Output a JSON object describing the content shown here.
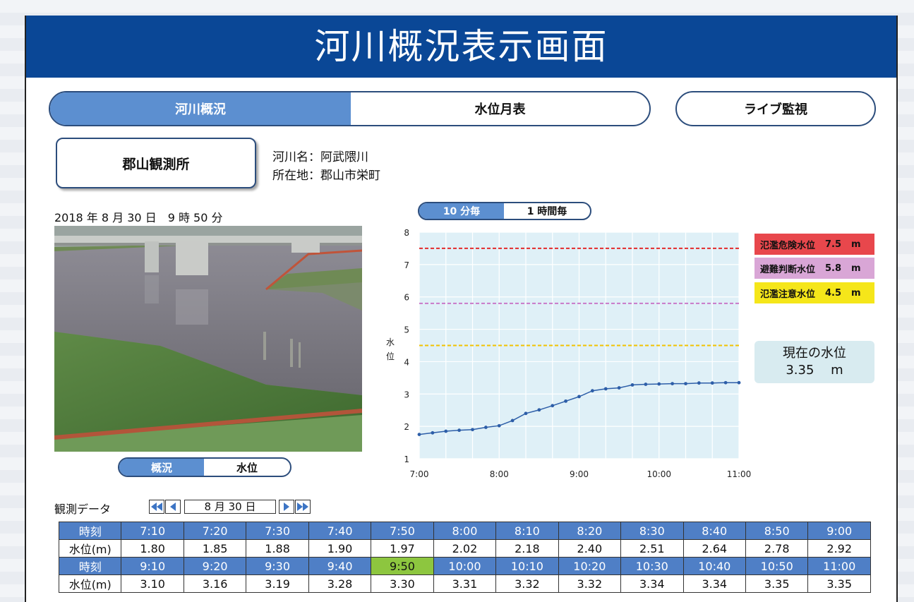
{
  "header": {
    "title": "河川概況表示画面"
  },
  "tabs": {
    "river_overview": "河川概況",
    "monthly_table": "水位月表",
    "live_monitor": "ライブ監視"
  },
  "station": {
    "name": "郡山観測所",
    "river_line": "河川名：阿武隈川",
    "location_line": "所在地：郡山市栄町"
  },
  "datetime": "2018 年 8 月 30 日　9 時 50 分",
  "camera_toggle": {
    "overview": "概況",
    "level": "水位"
  },
  "interval_toggle": {
    "ten_min": "10 分毎",
    "one_hour": "1 時間毎"
  },
  "chart_data": {
    "type": "line",
    "ylabel": "水位",
    "ylim": [
      1,
      8
    ],
    "yticks": [
      "1",
      "2",
      "3",
      "4",
      "5",
      "6",
      "7",
      "8"
    ],
    "xlim": [
      0,
      240
    ],
    "xticks": [
      {
        "t": 0,
        "label": "7:00"
      },
      {
        "t": 60,
        "label": "8:00"
      },
      {
        "t": 120,
        "label": "9:00"
      },
      {
        "t": 180,
        "label": "10:00"
      },
      {
        "t": 240,
        "label": "11:00"
      }
    ],
    "points": [
      [
        0,
        1.75
      ],
      [
        10,
        1.8
      ],
      [
        20,
        1.85
      ],
      [
        30,
        1.88
      ],
      [
        40,
        1.9
      ],
      [
        50,
        1.97
      ],
      [
        60,
        2.02
      ],
      [
        70,
        2.18
      ],
      [
        80,
        2.4
      ],
      [
        90,
        2.51
      ],
      [
        100,
        2.64
      ],
      [
        110,
        2.78
      ],
      [
        120,
        2.92
      ],
      [
        130,
        3.1
      ],
      [
        140,
        3.16
      ],
      [
        150,
        3.19
      ],
      [
        160,
        3.28
      ],
      [
        170,
        3.3
      ],
      [
        180,
        3.31
      ],
      [
        190,
        3.32
      ],
      [
        200,
        3.32
      ],
      [
        210,
        3.34
      ],
      [
        220,
        3.34
      ],
      [
        230,
        3.35
      ],
      [
        240,
        3.35
      ]
    ],
    "thresholds": [
      {
        "label": "氾濫危険水位",
        "value": 7.5,
        "text": "7.5",
        "unit": "m",
        "color": "#e32c2c",
        "bg": "#e8474c"
      },
      {
        "label": "避難判断水位",
        "value": 5.8,
        "text": "5.8",
        "unit": "m",
        "color": "#c97ac9",
        "bg": "#d9a6d6"
      },
      {
        "label": "氾濫注意水位",
        "value": 4.5,
        "text": "4.5",
        "unit": "m",
        "color": "#f2c200",
        "bg": "#f5e61a"
      }
    ],
    "plot_bg": "#dff0f7",
    "line_color": "#2d5ea8"
  },
  "current": {
    "label": "現在の水位",
    "value": "3.35",
    "unit": "m"
  },
  "observation": {
    "title": "観測データ",
    "date_label": "8 月 30 日",
    "time_header": "時刻",
    "level_header": "水位(m)",
    "rows": [
      {
        "times": [
          "7:10",
          "7:20",
          "7:30",
          "7:40",
          "7:50",
          "8:00",
          "8:10",
          "8:20",
          "8:30",
          "8:40",
          "8:50",
          "9:00"
        ],
        "levels": [
          "1.80",
          "1.85",
          "1.88",
          "1.90",
          "1.97",
          "2.02",
          "2.18",
          "2.40",
          "2.51",
          "2.64",
          "2.78",
          "2.92"
        ]
      },
      {
        "times": [
          "9:10",
          "9:20",
          "9:30",
          "9:40",
          "9:50",
          "10:00",
          "10:10",
          "10:20",
          "10:30",
          "10:40",
          "10:50",
          "11:00"
        ],
        "levels": [
          "3.10",
          "3.16",
          "3.19",
          "3.28",
          "3.30",
          "3.31",
          "3.32",
          "3.32",
          "3.34",
          "3.34",
          "3.35",
          "3.35"
        ]
      }
    ],
    "highlight": {
      "row": 1,
      "col": 4
    }
  },
  "colors": {
    "header_bg": "#0a4796",
    "tab_active": "#5c8fd0",
    "table_header": "#4f7fc6",
    "highlight": "#8dc63f"
  }
}
